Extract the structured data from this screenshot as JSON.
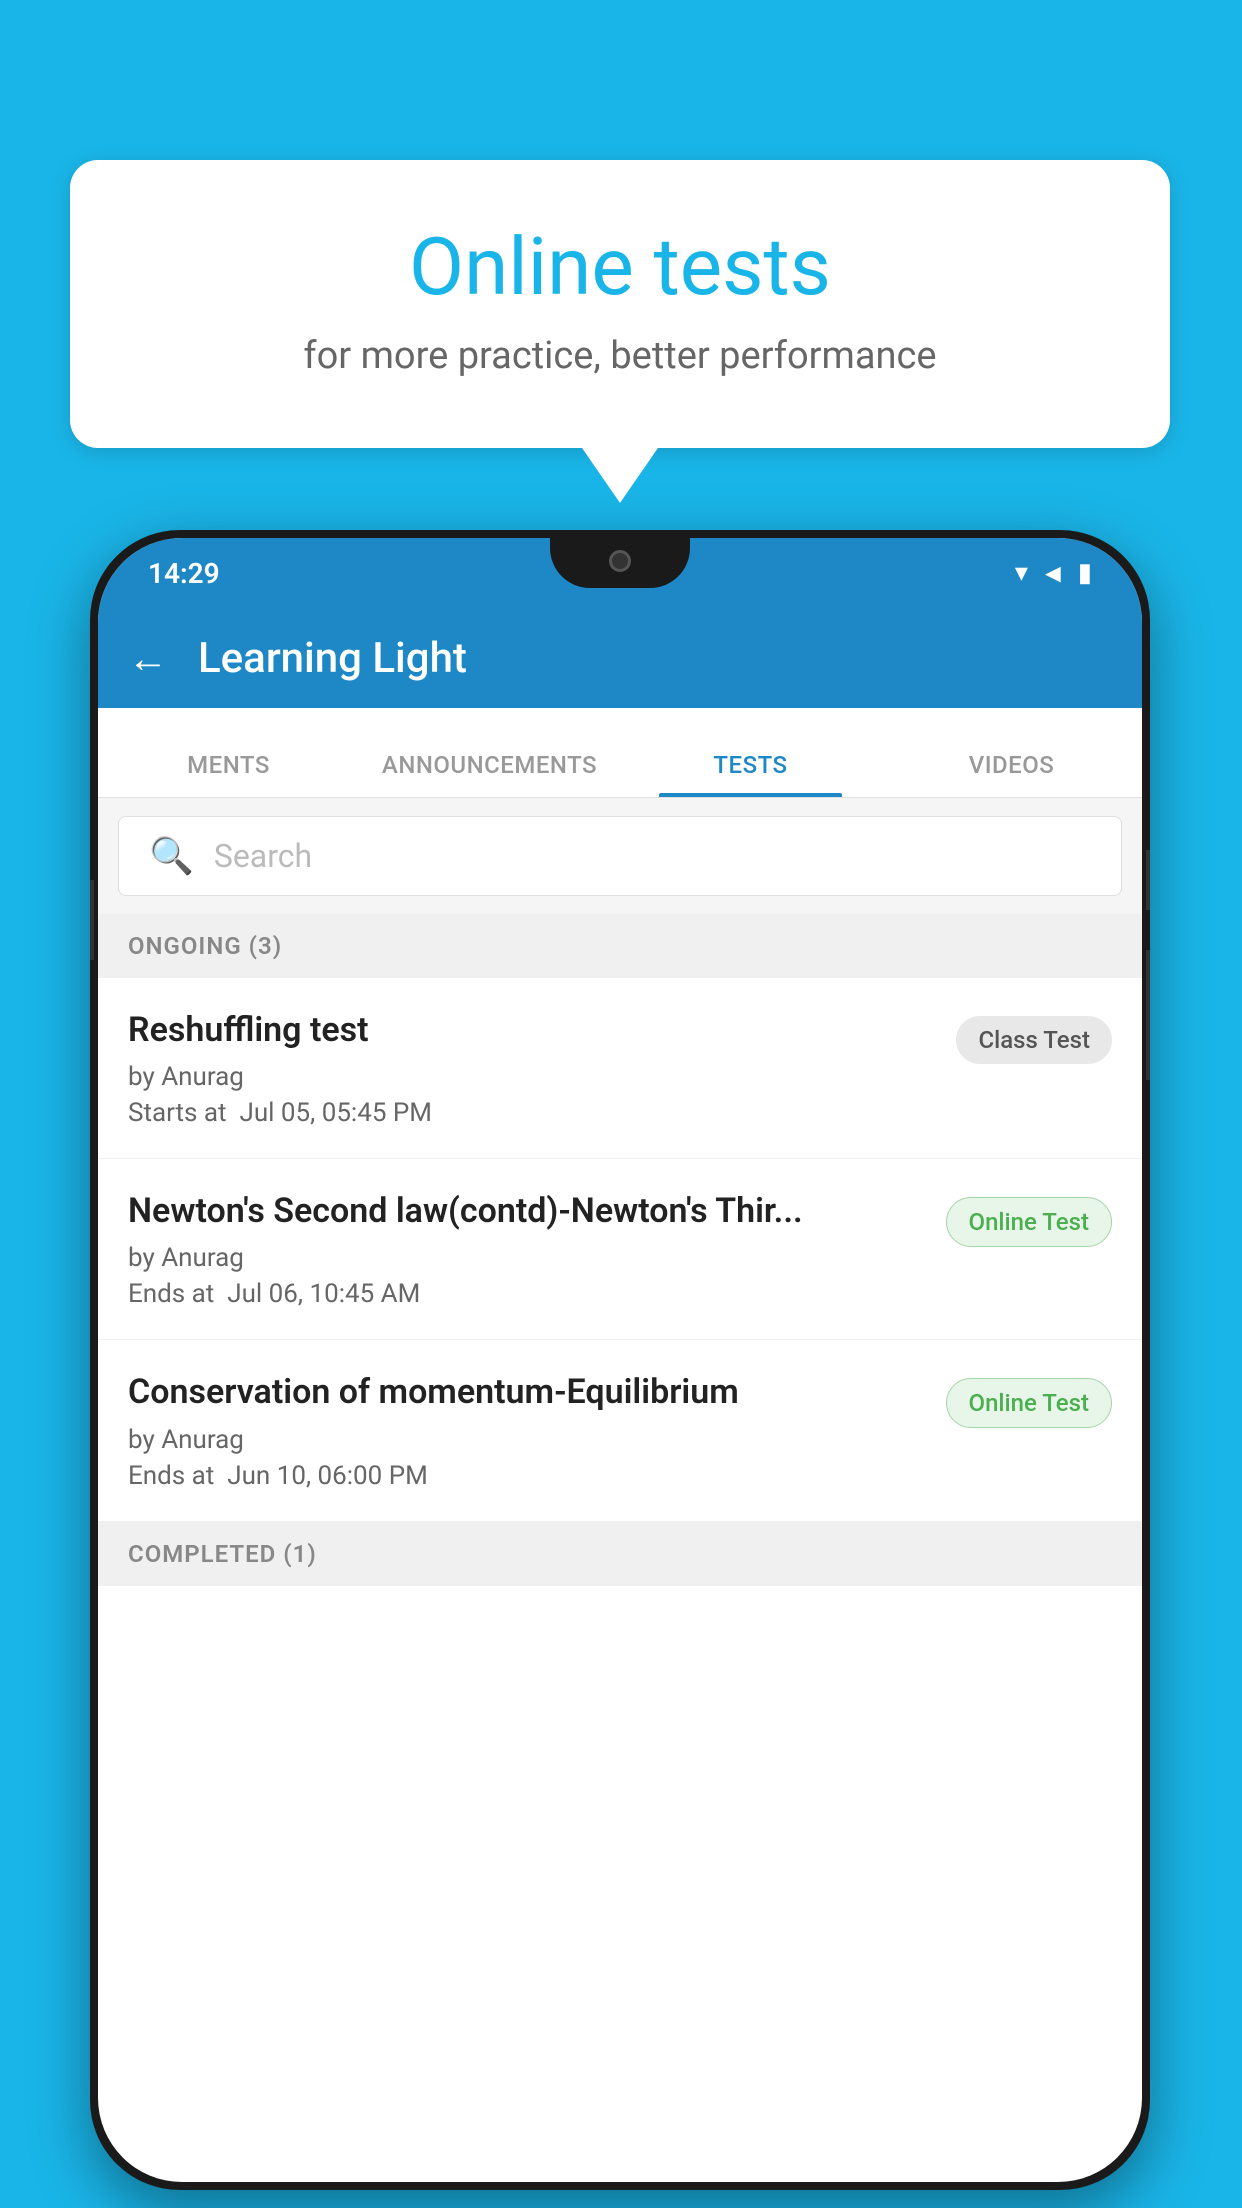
{
  "background_color": "#1ab5e8",
  "bubble": {
    "title": "Online tests",
    "subtitle": "for more practice, better performance"
  },
  "phone": {
    "status_bar": {
      "time": "14:29",
      "wifi": "▾",
      "signal": "▲",
      "battery": "▮"
    },
    "header": {
      "title": "Learning Light",
      "back_label": "←"
    },
    "tabs": [
      {
        "label": "MENTS",
        "active": false
      },
      {
        "label": "ANNOUNCEMENTS",
        "active": false
      },
      {
        "label": "TESTS",
        "active": true
      },
      {
        "label": "VIDEOS",
        "active": false
      }
    ],
    "search": {
      "placeholder": "Search"
    },
    "ongoing_section": {
      "label": "ONGOING (3)"
    },
    "tests": [
      {
        "name": "Reshuffling test",
        "by": "by Anurag",
        "date_label": "Starts at",
        "date": "Jul 05, 05:45 PM",
        "badge": "Class Test",
        "badge_type": "class"
      },
      {
        "name": "Newton's Second law(contd)-Newton's Thir...",
        "by": "by Anurag",
        "date_label": "Ends at",
        "date": "Jul 06, 10:45 AM",
        "badge": "Online Test",
        "badge_type": "online"
      },
      {
        "name": "Conservation of momentum-Equilibrium",
        "by": "by Anurag",
        "date_label": "Ends at",
        "date": "Jun 10, 06:00 PM",
        "badge": "Online Test",
        "badge_type": "online"
      }
    ],
    "completed_section": {
      "label": "COMPLETED (1)"
    }
  }
}
